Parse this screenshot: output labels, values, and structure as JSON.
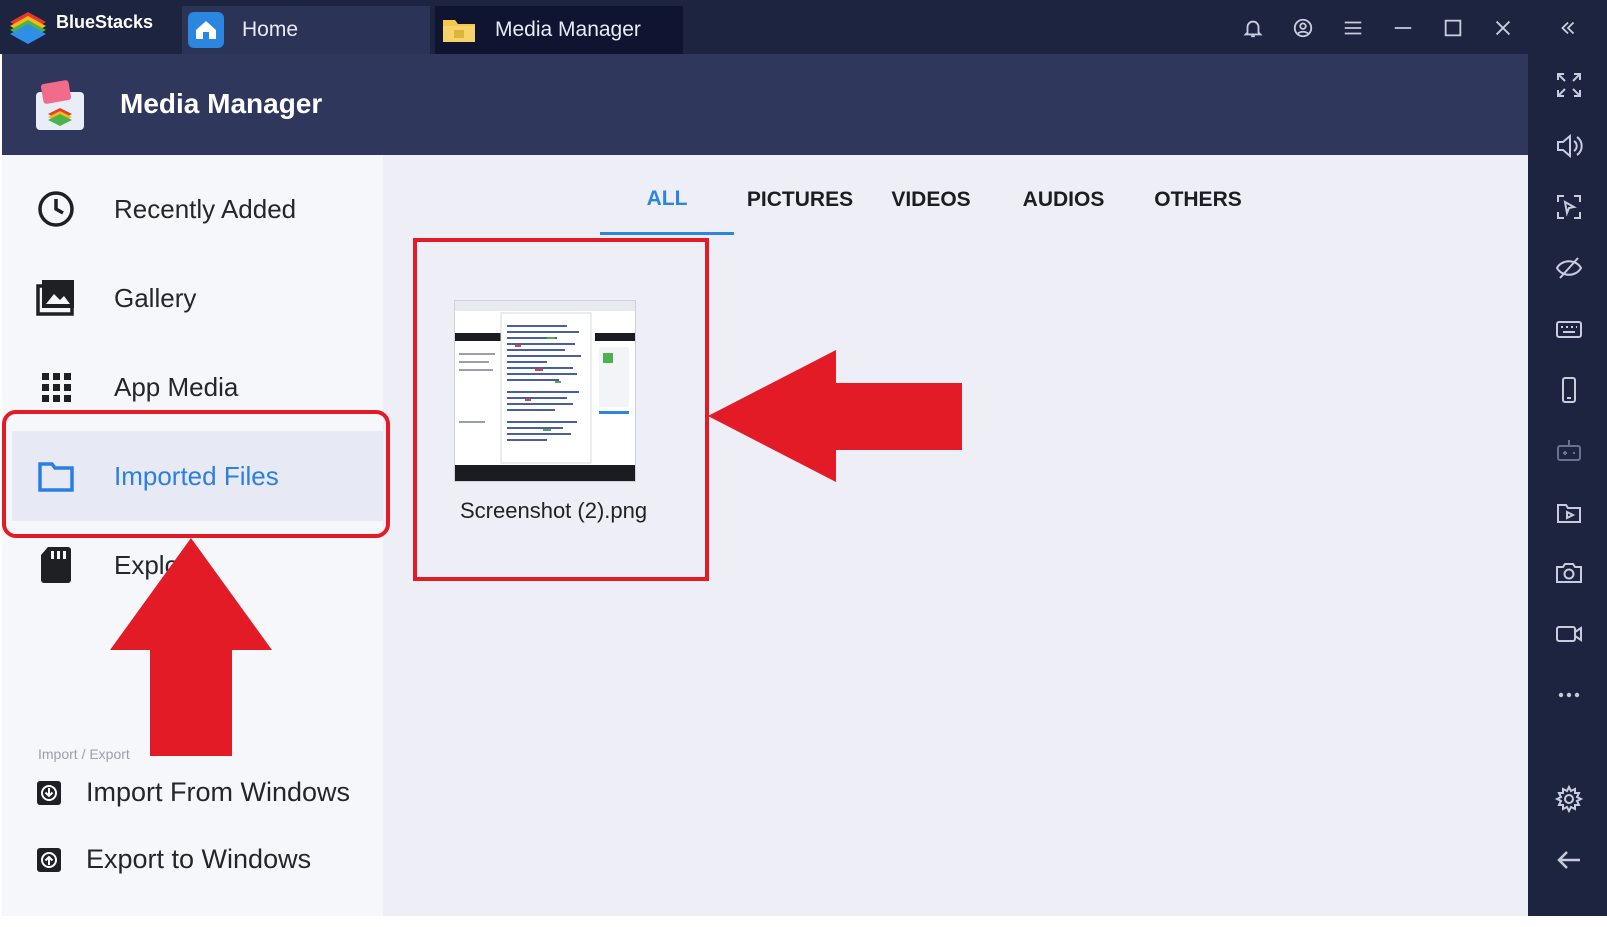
{
  "app": {
    "brand": "BlueStacks"
  },
  "tabs": [
    {
      "label": "Home",
      "icon": "home-icon"
    },
    {
      "label": "Media Manager",
      "icon": "folder-icon"
    }
  ],
  "header": {
    "title": "Media Manager"
  },
  "sidebar": {
    "items": [
      {
        "label": "Recently Added",
        "icon": "clock-icon"
      },
      {
        "label": "Gallery",
        "icon": "gallery-icon"
      },
      {
        "label": "App Media",
        "icon": "grid-icon"
      },
      {
        "label": "Imported Files",
        "icon": "folder-icon",
        "active": true
      },
      {
        "label": "Explo",
        "icon": "sd-card-icon"
      }
    ],
    "section_label": "Import / Export",
    "import_label": "Import From Windows",
    "export_label": "Export to Windows"
  },
  "filter_tabs": [
    {
      "label": "ALL",
      "active": true
    },
    {
      "label": "PICTURES"
    },
    {
      "label": "VIDEOS"
    },
    {
      "label": "AUDIOS"
    },
    {
      "label": "OTHERS"
    }
  ],
  "files": [
    {
      "name": "Screenshot (2).png"
    }
  ],
  "colors": {
    "titlebar": "#1d2440",
    "header": "#2f375c",
    "accent": "#2b86e0",
    "annotation": "#e21b26"
  }
}
